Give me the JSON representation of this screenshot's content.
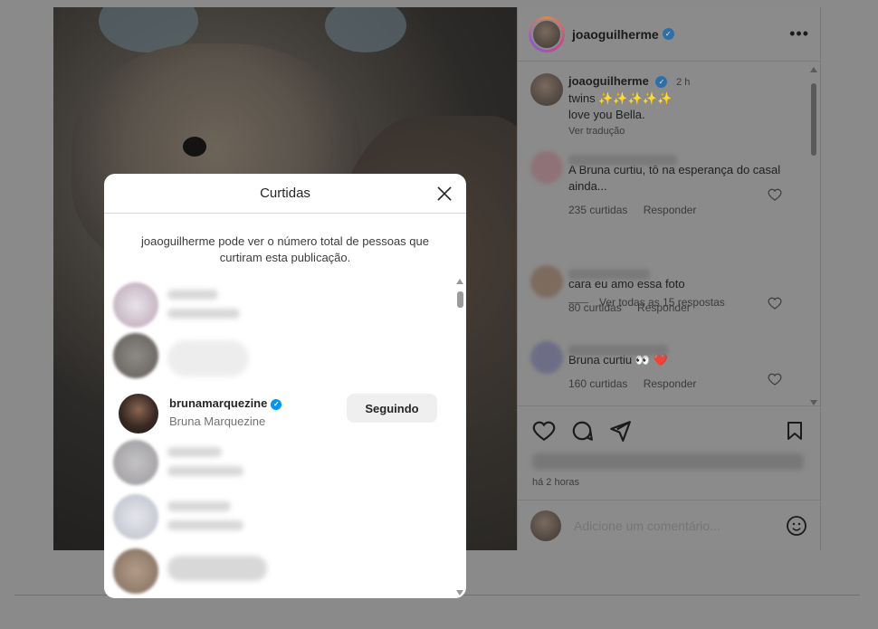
{
  "post": {
    "author": "joaoguilherme",
    "caption_line1": "twins ✨✨✨✨✨",
    "caption_line2": "love you Bella.",
    "caption_time": "2 h",
    "translate": "Ver tradução"
  },
  "comments": [
    {
      "text": "A Bruna curtiu, tô na esperança do casal ainda...",
      "likes": "235 curtidas",
      "reply": "Responder"
    },
    {
      "text": "cara eu amo essa foto",
      "likes": "80 curtidas",
      "reply": "Responder"
    },
    {
      "text": "Bruna curtiu 👀 ❤️",
      "likes": "160 curtidas",
      "reply": "Responder"
    }
  ],
  "view_replies": "Ver todas as 15 respostas",
  "actions": {
    "time_ago": "há 2 horas"
  },
  "add_comment": {
    "placeholder": "Adicione um comentário..."
  },
  "modal": {
    "title": "Curtidas",
    "info": "joaoguilherme pode ver o número total de pessoas que curtiram esta publicação.",
    "featured_user": {
      "username": "brunamarquezine",
      "full_name": "Bruna Marquezine",
      "button": "Seguindo"
    }
  },
  "icons": {
    "verified": "verified-badge-icon",
    "heart": "heart-icon",
    "comment": "comment-icon",
    "share": "share-icon",
    "bookmark": "bookmark-icon",
    "emoji": "emoji-icon",
    "close": "close-icon",
    "more": "more-options-icon"
  },
  "colors": {
    "overlay": "#8a8a8a",
    "verified_blue": "#0095f6",
    "button_bg": "#efefef"
  }
}
